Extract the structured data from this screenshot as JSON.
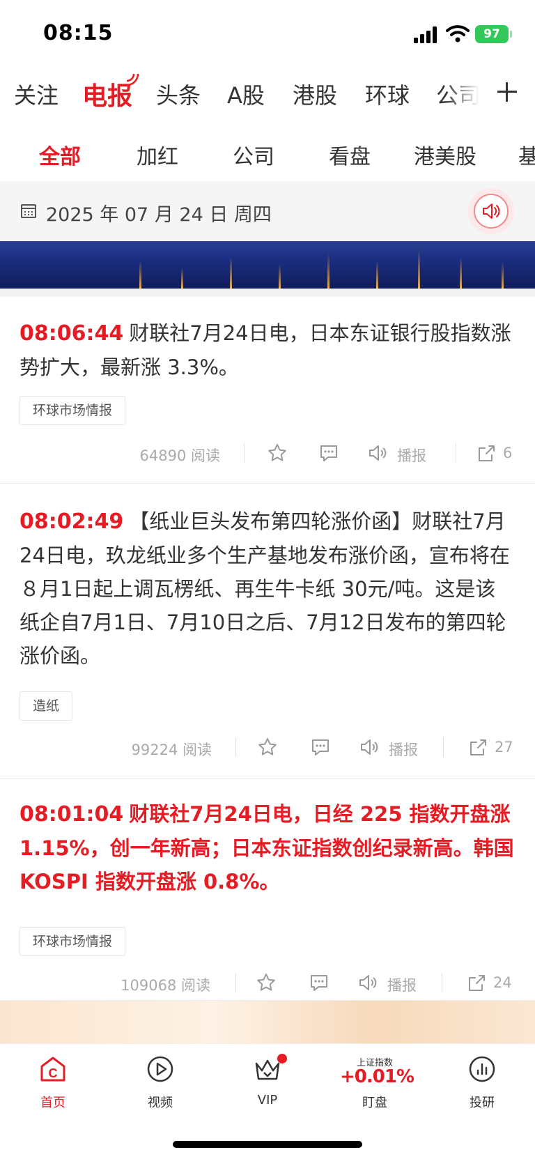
{
  "status_bar": {
    "time": "08:15",
    "battery": "97"
  },
  "channel_nav": {
    "tabs": [
      {
        "label": "关注"
      },
      {
        "label": "电报"
      },
      {
        "label": "头条"
      },
      {
        "label": "A股"
      },
      {
        "label": "港股"
      },
      {
        "label": "环球"
      },
      {
        "label": "公司"
      }
    ]
  },
  "sub_nav": {
    "tabs": [
      {
        "label": "全部"
      },
      {
        "label": "加红"
      },
      {
        "label": "公司"
      },
      {
        "label": "看盘"
      },
      {
        "label": "港美股"
      },
      {
        "label": "基"
      }
    ]
  },
  "date_bar": {
    "date": "2025 年 07 月 24 日  周四"
  },
  "news": [
    {
      "time": "08:06:44",
      "text": "财联社7月24日电，日本东证银行股指数涨势扩大，最新涨 3.3%。",
      "tag": "环球市场情报",
      "reads": "64890",
      "reads_label": "阅读",
      "broadcast_label": "播报",
      "shares": "6"
    },
    {
      "time": "08:02:49",
      "text": "【纸业巨头发布第四轮涨价函】财联社7月24日电，玖龙纸业多个生产基地发布涨价函，宣布将在８月1日起上调瓦楞纸、再生牛卡纸 30元/吨。这是该纸企自7月1日、7月10日之后、7月12日发布的第四轮涨价函。",
      "tag": "造纸",
      "reads": "99224",
      "reads_label": "阅读",
      "broadcast_label": "播报",
      "shares": "27"
    },
    {
      "time": "08:01:04",
      "text": "财联社7月24日电，日经 225 指数开盘涨1.15%，创一年新高；日本东证指数创纪录新高。韩国 KOSPI 指数开盘涨 0.8%。",
      "tag": "环球市场情报",
      "reads": "109068",
      "reads_label": "阅读",
      "broadcast_label": "播报",
      "shares": "24"
    }
  ],
  "tab_bar": {
    "home": "首页",
    "video": "视频",
    "vip": "VIP",
    "market_index_name": "上证指数",
    "market_index_value": "+0.01%",
    "market": "盯盘",
    "research": "投研"
  },
  "colors": {
    "accent": "#e51c23",
    "battery": "#34c759"
  }
}
